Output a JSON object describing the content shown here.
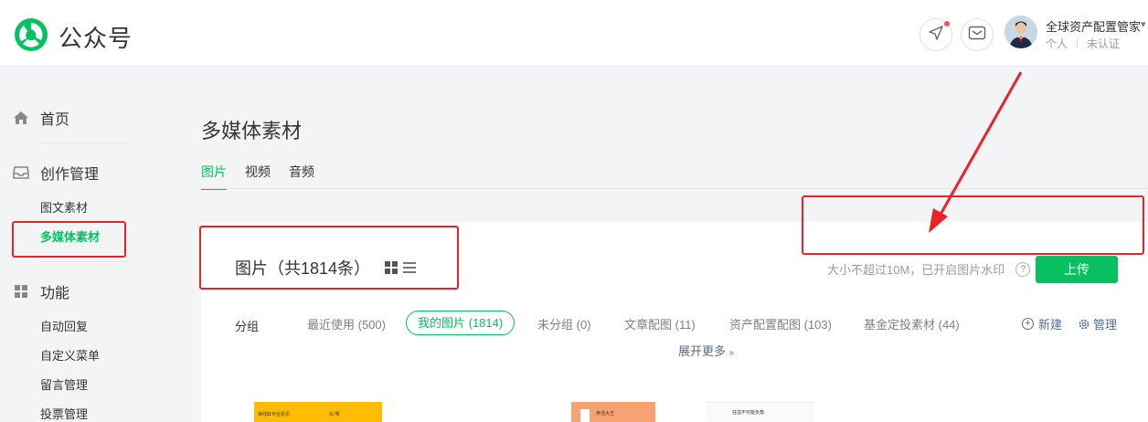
{
  "header": {
    "logo_text": "公众号",
    "account_name": "全球资产配置管家",
    "account_type": "个人",
    "account_status": "未认证"
  },
  "sidebar": {
    "home": "首页",
    "creation": {
      "label": "创作管理",
      "items": [
        "图文素材",
        "多媒体素材"
      ]
    },
    "features": {
      "label": "功能",
      "items": [
        "自动回复",
        "自定义菜单",
        "留言管理",
        "投票管理"
      ]
    }
  },
  "main": {
    "title": "多媒体素材",
    "tabs": [
      "图片",
      "视频",
      "音频"
    ],
    "panel_title": "图片（共1814条）",
    "upload_tip": "大小不超过10M，已开启图片水印",
    "upload_button": "上传",
    "group_label": "分组",
    "groups": [
      "最近使用 (500)",
      "我的图片 (1814)",
      "未分组 (0)",
      "文章配图 (11)",
      "资产配置配图 (103)",
      "基金定投素材 (44)"
    ],
    "new_label": "新建",
    "manage_label": "管理",
    "expand_label": "展开更多",
    "thumbnails": [
      {
        "a": "接线缸专业机讯",
        "b": "出 明"
      },
      {
        "a": "养活大王"
      },
      {
        "a": "任溢不可能负角"
      }
    ]
  },
  "colors": {
    "brand_green": "#07c160",
    "annotation_red": "#e8232a",
    "link_blue": "#576b95"
  },
  "icons": [
    "logo-icon",
    "send-icon",
    "mail-icon",
    "home-icon",
    "inbox-icon",
    "apps-icon",
    "help-icon",
    "grid-view-icon",
    "list-view-icon",
    "plus-circle-icon",
    "gear-icon",
    "chevron-down-icon"
  ]
}
